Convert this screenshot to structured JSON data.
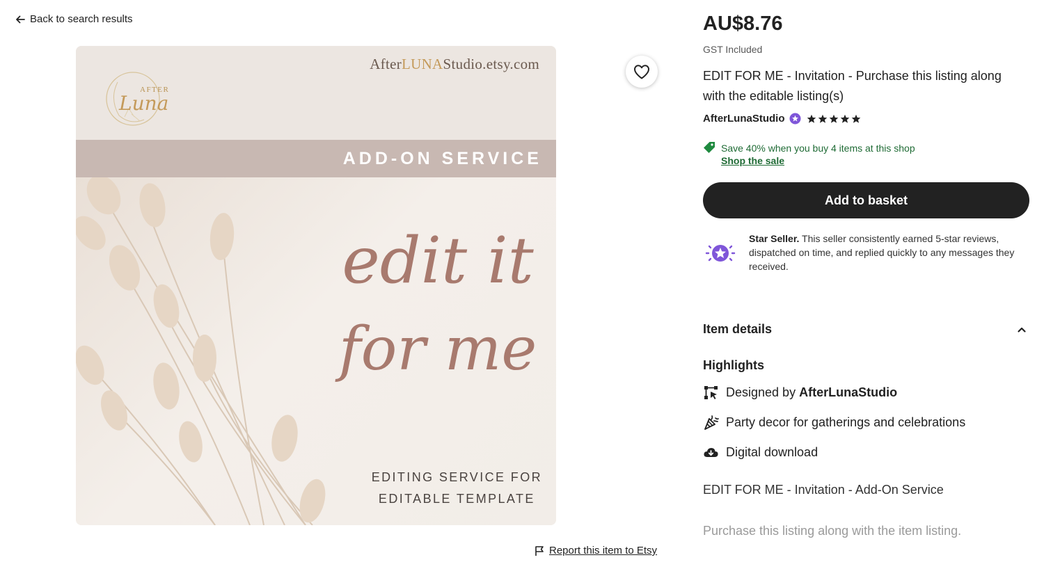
{
  "nav": {
    "back_label": "Back to search results"
  },
  "image": {
    "domain_prefix": "After",
    "domain_brand": "LUNA",
    "domain_suffix": "Studio.etsy.com",
    "logo_text_top": "AFTER",
    "logo_text_script": "Luna",
    "band_text": "ADD-ON SERVICE",
    "script_line1": "edit it",
    "script_line2": "for me",
    "caption_line1": "EDITING SERVICE FOR",
    "caption_line2": "EDITABLE TEMPLATE"
  },
  "report": {
    "label": "Report this item to Etsy"
  },
  "product": {
    "price": "AU$8.76",
    "tax_note": "GST Included",
    "title": "EDIT FOR ME - Invitation - Purchase this listing along with the editable listing(s)",
    "shop_name": "AfterLunaStudio",
    "rating": 5,
    "max_rating": 5
  },
  "promo": {
    "text": "Save 40% when you buy 4 items at this shop",
    "link": "Shop the sale"
  },
  "actions": {
    "add_to_basket": "Add to basket"
  },
  "star_seller": {
    "title": "Star Seller.",
    "text": " This seller consistently earned 5-star reviews, dispatched on time, and replied quickly to any messages they received."
  },
  "details": {
    "header": "Item details",
    "highlights_title": "Highlights",
    "highlights": [
      {
        "prefix": "Designed by ",
        "bold": "AfterLunaStudio",
        "icon": "designer-icon"
      },
      {
        "prefix": "Party decor for gatherings and celebrations",
        "bold": "",
        "icon": "party-popper-icon"
      },
      {
        "prefix": "Digital download",
        "bold": "",
        "icon": "cloud-download-icon"
      }
    ],
    "description_line1": "EDIT FOR ME - Invitation - Add-On Service",
    "description_line2": "Purchase this listing along with the item listing."
  },
  "colors": {
    "button_bg": "#222222",
    "promo_green": "#1f6b35",
    "star_seller_purple": "#7f56d9",
    "band": "#c8b8b2",
    "script": "#a87a6e"
  }
}
